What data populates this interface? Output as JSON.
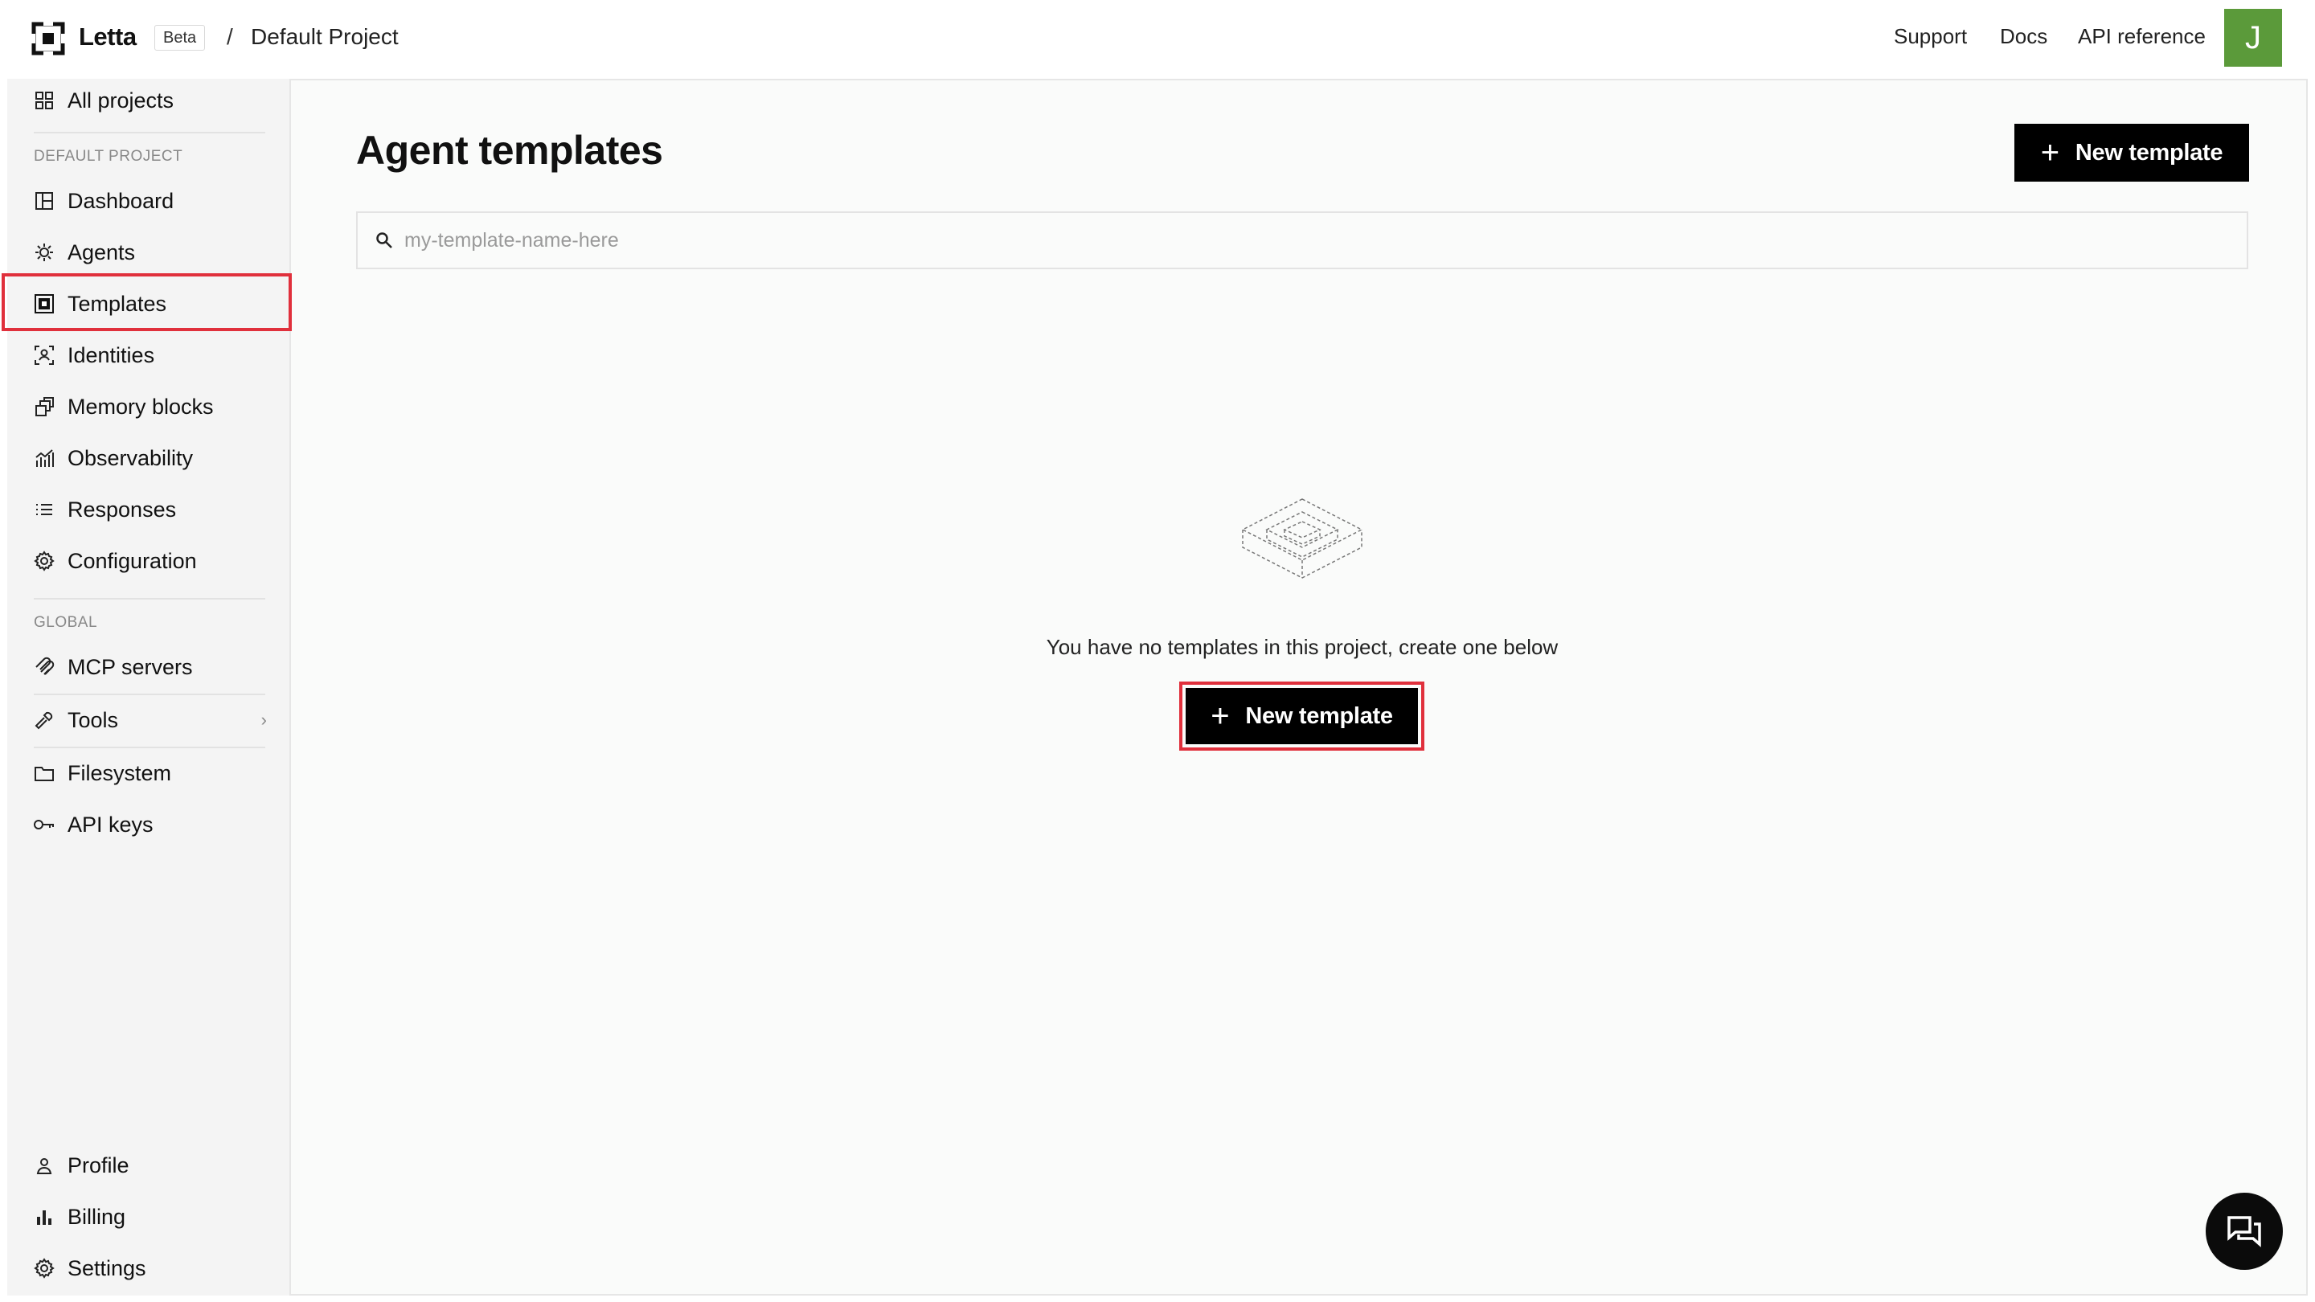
{
  "header": {
    "brand": "Letta",
    "badge": "Beta",
    "separator": "/",
    "project": "Default Project",
    "links": [
      "Support",
      "Docs",
      "API reference"
    ],
    "avatar_initial": "J",
    "avatar_color": "#5b9a3a"
  },
  "sidebar": {
    "all_projects": "All projects",
    "section_project": "DEFAULT PROJECT",
    "project_items": [
      {
        "label": "Dashboard",
        "icon": "dashboard-icon"
      },
      {
        "label": "Agents",
        "icon": "agents-icon"
      },
      {
        "label": "Templates",
        "icon": "templates-icon",
        "active": true
      },
      {
        "label": "Identities",
        "icon": "identities-icon"
      },
      {
        "label": "Memory blocks",
        "icon": "memory-blocks-icon"
      },
      {
        "label": "Observability",
        "icon": "observability-icon"
      },
      {
        "label": "Responses",
        "icon": "responses-icon"
      },
      {
        "label": "Configuration",
        "icon": "configuration-icon"
      }
    ],
    "section_global": "GLOBAL",
    "global_items": [
      {
        "label": "MCP servers",
        "icon": "mcp-icon"
      },
      {
        "label": "Tools",
        "icon": "tools-icon",
        "has_submenu": true
      },
      {
        "label": "Filesystem",
        "icon": "folder-icon"
      },
      {
        "label": "API keys",
        "icon": "key-icon"
      }
    ],
    "bottom_items": [
      {
        "label": "Profile",
        "icon": "profile-icon"
      },
      {
        "label": "Billing",
        "icon": "billing-icon"
      },
      {
        "label": "Settings",
        "icon": "settings-icon"
      }
    ]
  },
  "main": {
    "title": "Agent templates",
    "new_button": "New template",
    "search_placeholder": "my-template-name-here",
    "empty_message": "You have no templates in this project, create one below",
    "empty_cta": "New template"
  },
  "colors": {
    "highlight": "#e0303c",
    "primary_button": "#000000"
  }
}
